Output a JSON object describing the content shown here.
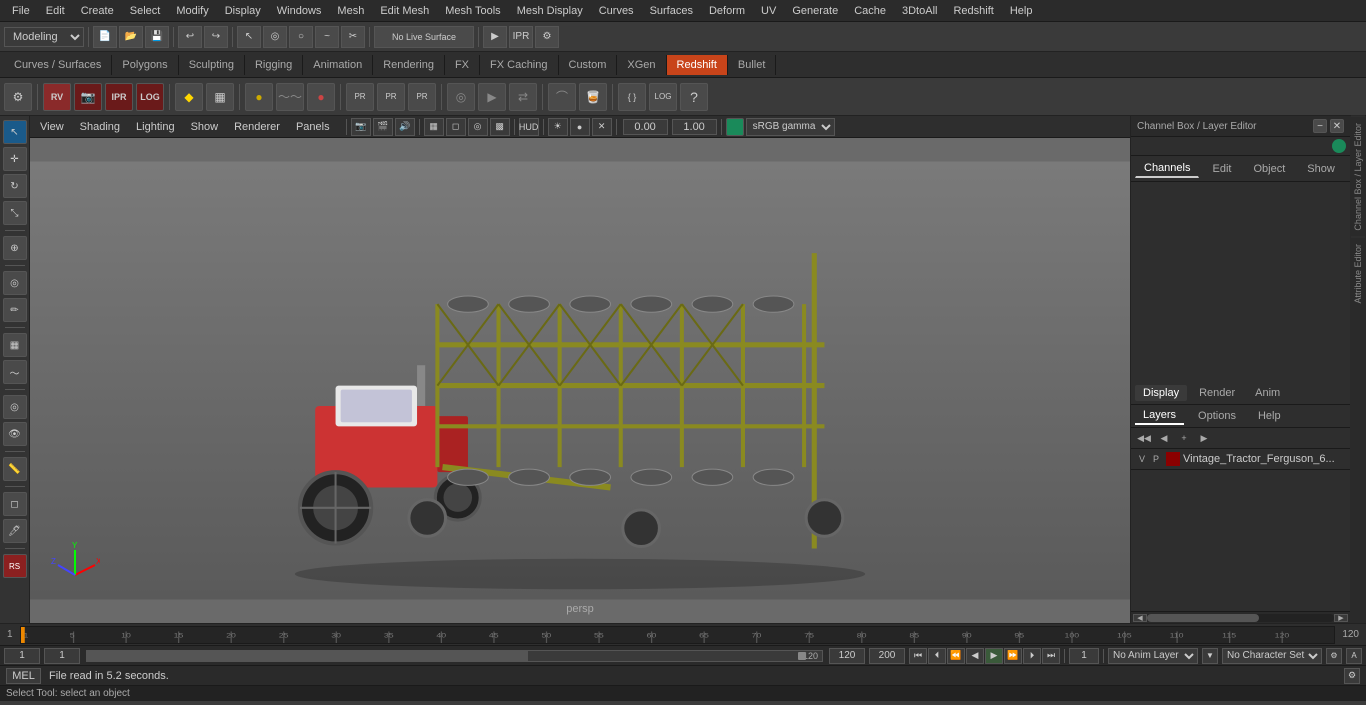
{
  "app": {
    "title": "Autodesk Maya"
  },
  "menu": {
    "items": [
      "File",
      "Edit",
      "Create",
      "Select",
      "Modify",
      "Display",
      "Windows",
      "Mesh",
      "Edit Mesh",
      "Mesh Tools",
      "Mesh Display",
      "Curves",
      "Surfaces",
      "Deform",
      "UV",
      "Generate",
      "Cache",
      "3DtoAll",
      "Redshift",
      "Help"
    ]
  },
  "toolbar": {
    "workspace": "Modeling",
    "no_live_surface": "No Live Surface"
  },
  "tabs": {
    "items": [
      "Curves / Surfaces",
      "Polygons",
      "Sculpting",
      "Rigging",
      "Animation",
      "Rendering",
      "FX",
      "FX Caching",
      "Custom",
      "XGen",
      "Redshift",
      "Bullet"
    ]
  },
  "viewport": {
    "menus": [
      "View",
      "Shading",
      "Lighting",
      "Show",
      "Renderer",
      "Panels"
    ],
    "camera": "persp",
    "gamma": "sRGB gamma",
    "coord_x": "0.00",
    "coord_y": "1.00"
  },
  "channel_box": {
    "title": "Channel Box / Layer Editor",
    "tabs": [
      "Channels",
      "Edit",
      "Object",
      "Show"
    ],
    "display_tabs": [
      "Display",
      "Render",
      "Anim"
    ],
    "layer_tabs": [
      "Layers",
      "Options",
      "Help"
    ],
    "layer_row": {
      "v": "V",
      "p": "P",
      "name": "Vintage_Tractor_Ferguson_6..."
    }
  },
  "right_strip": {
    "labels": [
      "Channel Box / Layer Editor",
      "Attribute Editor"
    ]
  },
  "timeline": {
    "start": "1",
    "end": "120",
    "current": "1",
    "ticks": [
      "1",
      "5",
      "10",
      "15",
      "20",
      "25",
      "30",
      "35",
      "40",
      "45",
      "50",
      "55",
      "60",
      "65",
      "70",
      "75",
      "80",
      "85",
      "90",
      "95",
      "100",
      "105",
      "110",
      "115",
      "120"
    ]
  },
  "controls": {
    "frame_start": "1",
    "frame_end": "1",
    "current_frame": "1",
    "playback_end": "120",
    "max_frame": "120",
    "total_frames": "200",
    "anim_layer": "No Anim Layer",
    "char_set": "No Character Set"
  },
  "status": {
    "mode": "MEL",
    "message": "File read in  5.2 seconds.",
    "tooltip": "Select Tool: select an object"
  },
  "icons": {
    "play": "▶",
    "prev_frame": "◀",
    "next_frame": "▶",
    "rewind": "⏮",
    "fast_forward": "⏭",
    "prev_key": "⏪",
    "next_key": "⏩",
    "step_back": "⏴",
    "step_fwd": "⏵"
  }
}
